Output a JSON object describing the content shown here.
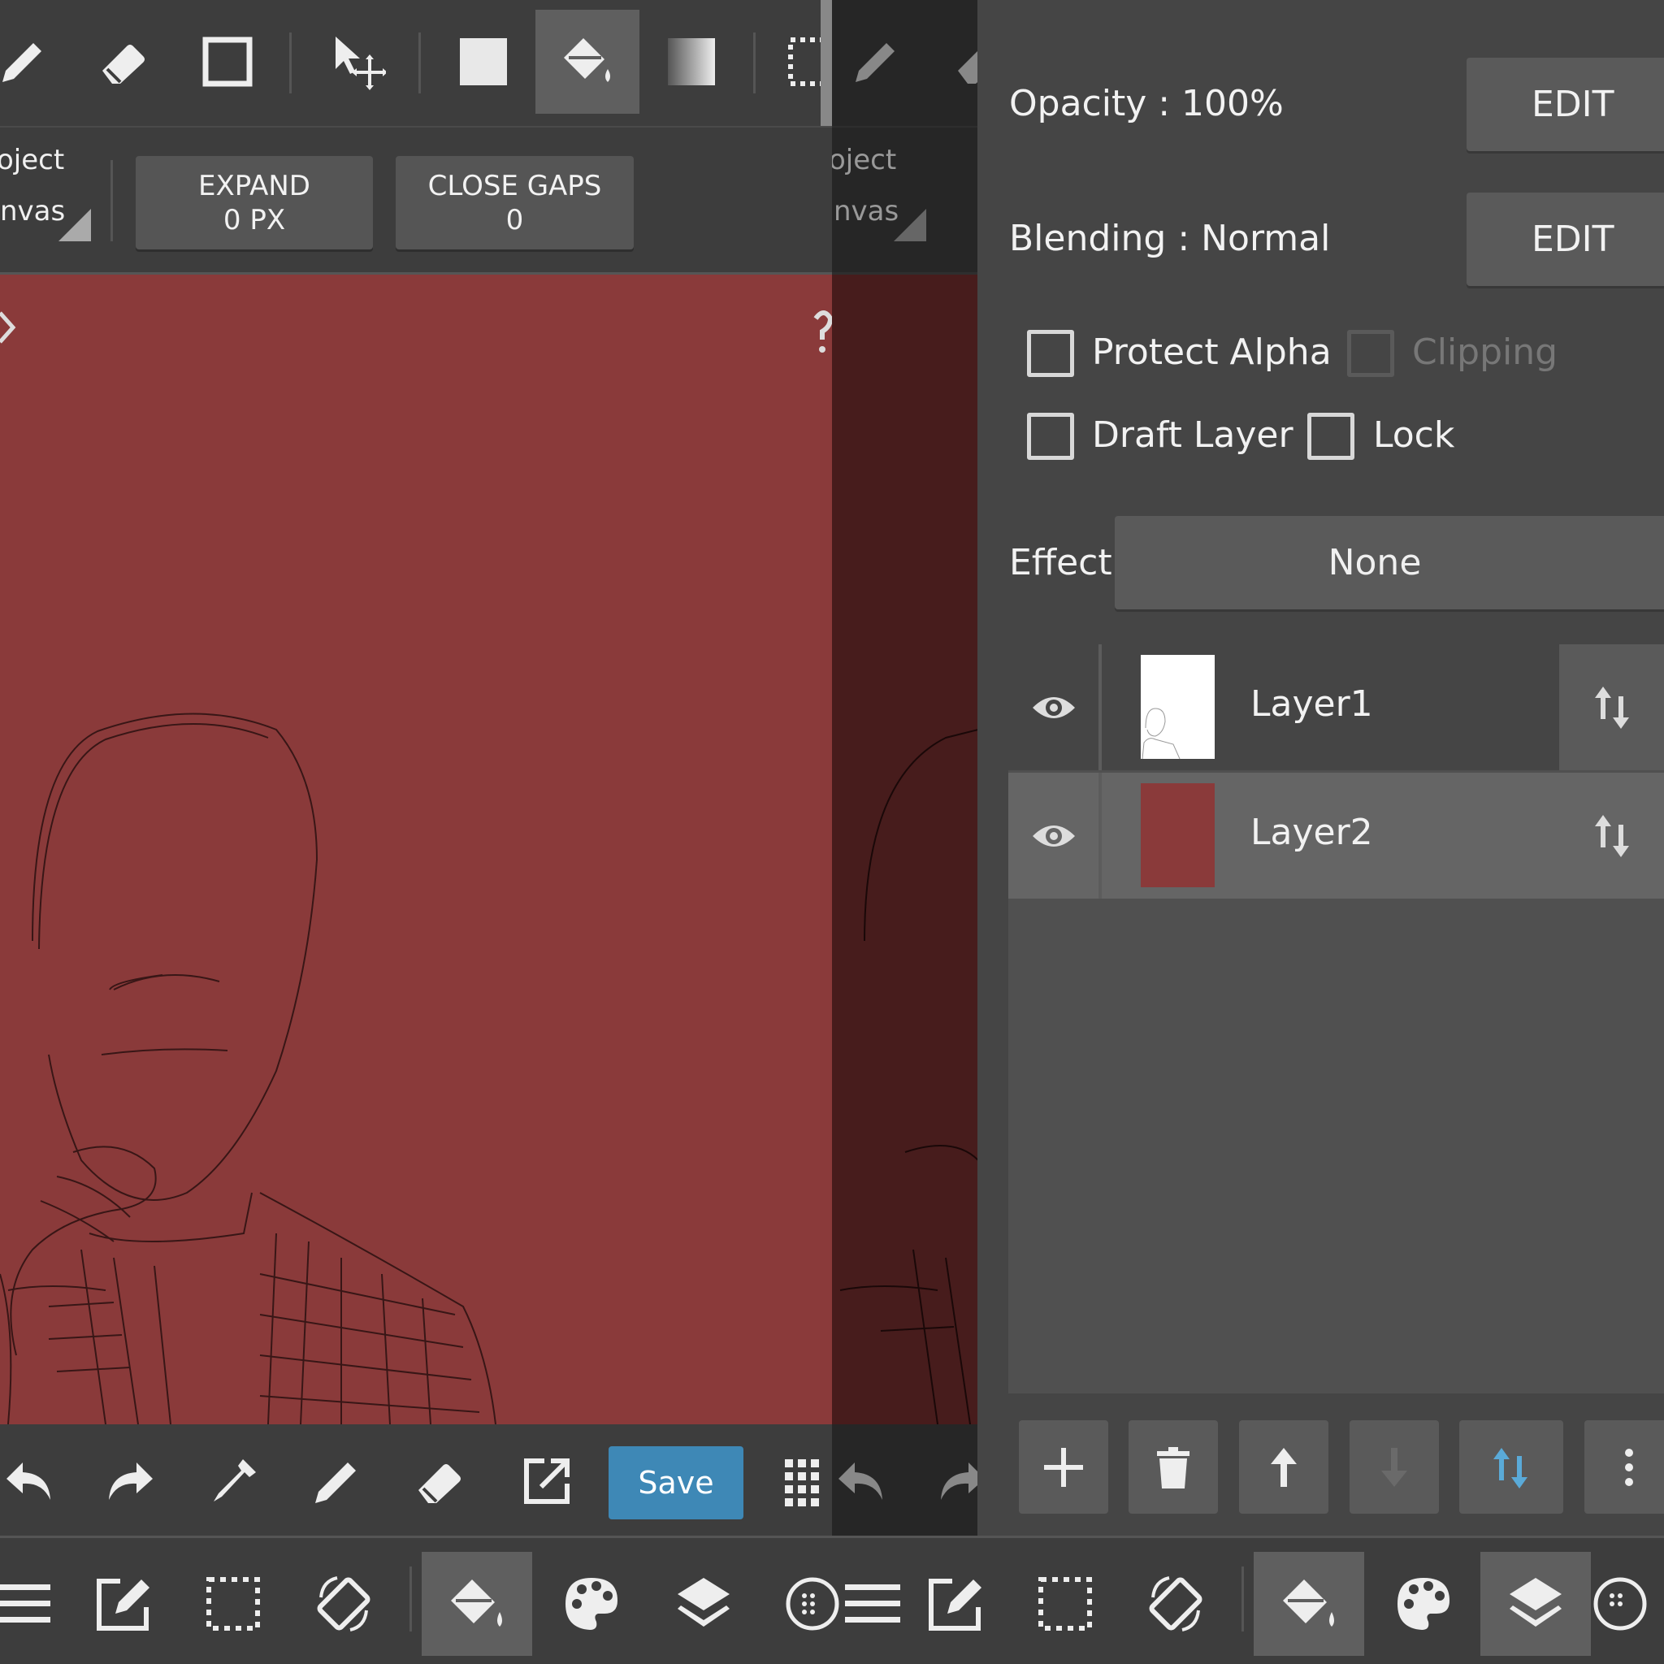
{
  "colors": {
    "canvas": "#8a3a3a",
    "canvas_dimmed": "#471c1c",
    "toolbar": "#3d3d3d",
    "panel": "#454545",
    "accent_blue": "#5aaad8",
    "save": "#3e88b6"
  },
  "toolbar": {
    "tools": [
      "pencil-icon",
      "eraser-icon",
      "rect-select-icon",
      "move-icon",
      "fill-square-icon",
      "bucket-icon",
      "gradient-icon",
      "dotted-select-icon"
    ],
    "active_tool": "bucket-icon"
  },
  "subtoolbar": {
    "object_label": "oject",
    "canvas_label": "nvas",
    "expand_title": "EXPAND",
    "expand_value": "0 PX",
    "close_gaps_title": "CLOSE GAPS",
    "close_gaps_value": "0",
    "object_label_dim": "oject",
    "canvas_label_dim": "nvas"
  },
  "bottom": {
    "save_label": "Save"
  },
  "panel": {
    "opacity_label": "Opacity : 100%",
    "opacity_edit": "EDIT",
    "blending_label": "Blending : Normal",
    "blending_edit": "EDIT",
    "protect_alpha": "Protect Alpha",
    "clipping": "Clipping",
    "draft_layer": "Draft Layer",
    "lock": "Lock",
    "effect_label": "Effect",
    "effect_value": "None",
    "layers": [
      {
        "name": "Layer1",
        "thumb": "white",
        "visible": true
      },
      {
        "name": "Layer2",
        "thumb": "#8a3a3a",
        "visible": true,
        "selected": true
      }
    ]
  }
}
